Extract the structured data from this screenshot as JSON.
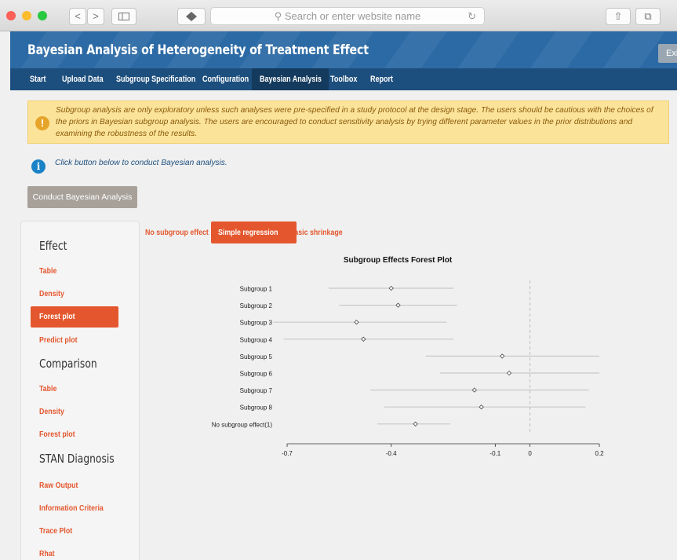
{
  "browser": {
    "url_placeholder": "Search or enter website name",
    "search_glyph": "⚲",
    "nav_back": "<",
    "nav_forward": ">",
    "reload_glyph": "↻",
    "share_glyph": "⇧",
    "tabs_glyph": "⧉",
    "colors": {
      "close": "#fc5f57",
      "minimize": "#fdbc2e",
      "zoom": "#28c840"
    }
  },
  "app": {
    "title": "Bayesian Analysis of Heterogeneity of Treatment Effect",
    "exit_label": "Exit"
  },
  "nav": {
    "items": [
      "Start",
      "Upload Data",
      "Subgroup Specification",
      "Configuration",
      "Bayesian Analysis",
      "Toolbox",
      "Report"
    ],
    "active": "Bayesian Analysis"
  },
  "warning": {
    "icon": "!",
    "lines": [
      "Subgroup analysis are only exploratory unless such analyses were pre-specified in a study protocol at the design stage. The users should be cautious with the choices of",
      "the priors in Bayesian subgroup analysis. The users are encouraged to conduct sensitivity analysis by trying different parameter values in the prior distributions and",
      "examining the robustness of the results."
    ]
  },
  "info": {
    "icon": "i",
    "text": "Click button below to conduct Bayesian analysis."
  },
  "run_button": "Conduct Bayesian Analysis",
  "sidebar": {
    "sections": [
      {
        "title": "Effect",
        "items": [
          "Table",
          "Density",
          "Forest plot",
          "Predict plot"
        ]
      },
      {
        "title": "Comparison",
        "items": [
          "Table",
          "Density",
          "Forest plot"
        ]
      },
      {
        "title": "STAN Diagnosis",
        "items": [
          "Raw Output",
          "Information Criteria",
          "Trace Plot",
          "Rhat"
        ]
      }
    ],
    "active_item": "Effect / Forest plot"
  },
  "pills": {
    "items": [
      "No subgroup effect",
      "Simple regression",
      "Basic shrinkage"
    ],
    "active": "Simple regression"
  },
  "chart_data": {
    "type": "forest",
    "title": "Subgroup Effects Forest Plot",
    "categories": [
      "Subgroup 1",
      "Subgroup 2",
      "Subgroup 3",
      "Subgroup 4",
      "Subgroup 5",
      "Subgroup 6",
      "Subgroup 7",
      "Subgroup 8",
      "No subgroup effect(1)"
    ],
    "estimates": [
      -0.4,
      -0.38,
      -0.5,
      -0.48,
      -0.08,
      -0.06,
      -0.16,
      -0.14,
      -0.33
    ],
    "lower": [
      -0.58,
      -0.55,
      -0.74,
      -0.71,
      -0.3,
      -0.26,
      -0.46,
      -0.42,
      -0.44
    ],
    "upper": [
      -0.22,
      -0.21,
      -0.24,
      -0.22,
      0.2,
      0.2,
      0.17,
      0.16,
      -0.23
    ],
    "reference_line": 0,
    "xlim": [
      -0.7,
      0.2
    ],
    "xticks": [
      -0.7,
      -0.4,
      -0.1,
      0,
      0.2
    ],
    "xtick_labels": [
      "-0.7",
      "-0.4",
      "-0.1",
      "0",
      "0.2"
    ],
    "colors": {
      "interval": "#c8c8c8",
      "reference": "#bdbdbd",
      "marker": "#444444"
    }
  }
}
